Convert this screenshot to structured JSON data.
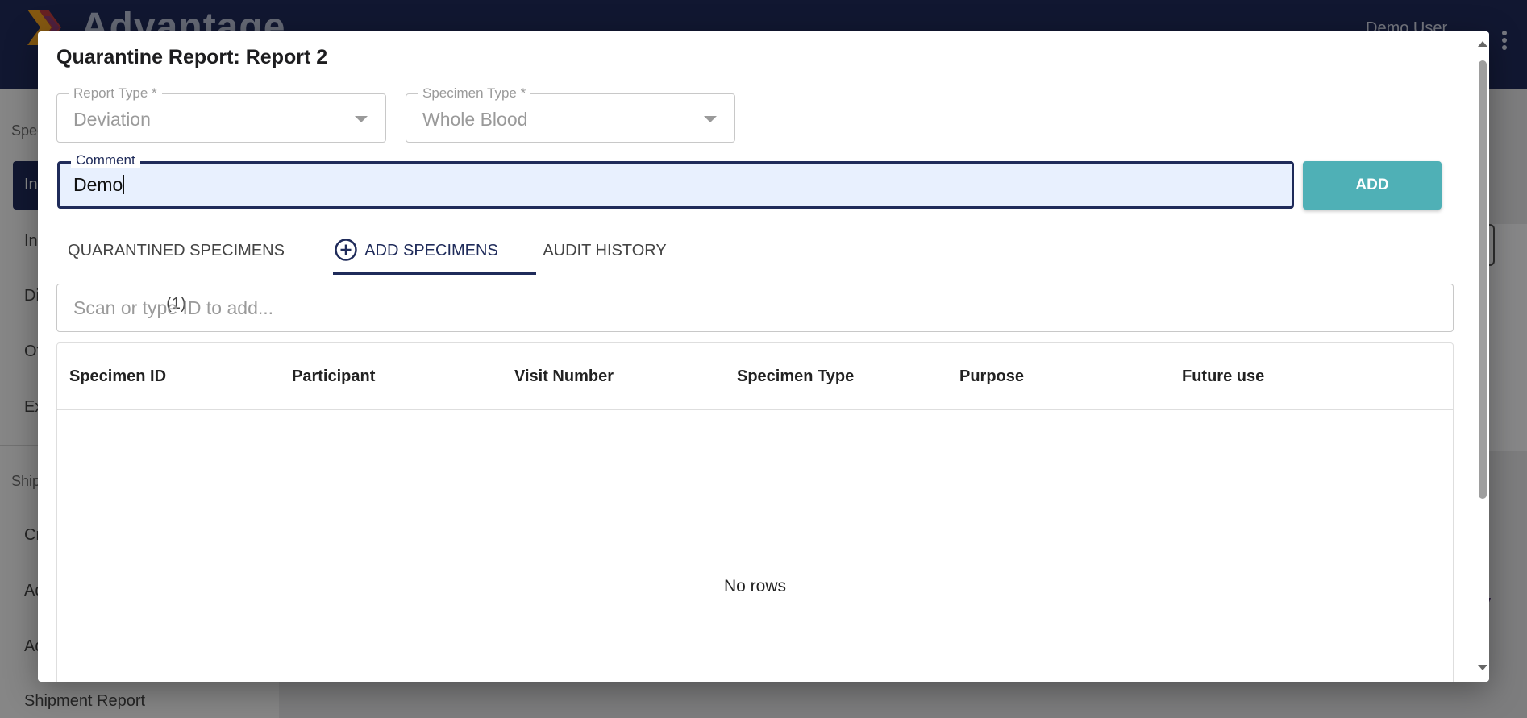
{
  "app": {
    "logo_text": "Advantage",
    "user_name": "Demo User"
  },
  "sidebar": {
    "sections": [
      "Spec",
      "Ship"
    ],
    "items": [
      "In",
      "In",
      "Di",
      "Ot",
      "Ex",
      "Cr",
      "Ad",
      "Ad",
      "Shipment Report"
    ]
  },
  "background": {
    "link_fragment": "y"
  },
  "modal": {
    "title": "Quarantine Report: Report 2",
    "report_type": {
      "label": "Report Type *",
      "value": "Deviation"
    },
    "specimen_type": {
      "label": "Specimen Type *",
      "value": "Whole Blood"
    },
    "comment": {
      "label": "Comment",
      "value": "Demo"
    },
    "add_button": "ADD",
    "tabs": [
      {
        "label": "QUARANTINED SPECIMENS (1)",
        "active": false
      },
      {
        "label": "ADD SPECIMENS",
        "active": true,
        "icon": "plus-circle-icon"
      },
      {
        "label": "AUDIT HISTORY",
        "active": false
      }
    ],
    "scan": {
      "placeholder": "Scan or type ID to add..."
    },
    "table": {
      "columns": [
        "Specimen ID",
        "Participant",
        "Visit Number",
        "Specimen Type",
        "Purpose",
        "Future use"
      ],
      "empty_text": "No rows"
    }
  },
  "colors": {
    "navy": "#1f2b5a",
    "teal_button": "#4fb0b6",
    "comment_fill": "#e8f0fe",
    "logo_orange": "#f0a020",
    "logo_red": "#d8413a",
    "logo_purple": "#7a3a8c"
  }
}
